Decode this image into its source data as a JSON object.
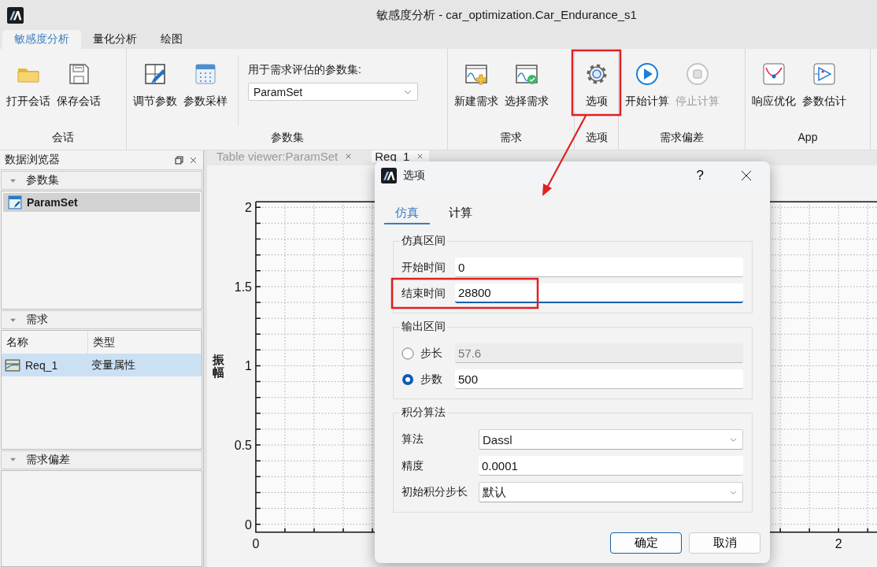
{
  "window": {
    "title": "敏感度分析 - car_optimization.Car_Endurance_s1"
  },
  "ribbon_tabs": [
    {
      "label": "敏感度分析",
      "selected": true
    },
    {
      "label": "量化分析",
      "selected": false
    },
    {
      "label": "绘图",
      "selected": false
    }
  ],
  "ribbon_groups": [
    {
      "title": "会话",
      "buttons": [
        {
          "label": "打开会话",
          "disabled": false
        },
        {
          "label": "保存会话",
          "disabled": false
        }
      ]
    },
    {
      "title": "参数集",
      "buttons": [
        {
          "label": "调节参数",
          "disabled": false
        },
        {
          "label": "参数采样",
          "disabled": false
        }
      ],
      "combo": {
        "label": "用于需求评估的参数集:",
        "value": "ParamSet"
      }
    },
    {
      "title": "需求",
      "buttons": [
        {
          "label": "新建需求",
          "disabled": false
        },
        {
          "label": "选择需求",
          "disabled": false
        }
      ]
    },
    {
      "title": "选项",
      "buttons": [
        {
          "label": "选项",
          "disabled": false
        }
      ]
    },
    {
      "title": "需求偏差",
      "buttons": [
        {
          "label": "开始计算",
          "disabled": false
        },
        {
          "label": "停止计算",
          "disabled": true
        }
      ]
    },
    {
      "title": "App",
      "buttons": [
        {
          "label": "响应优化",
          "disabled": false
        },
        {
          "label": "参数估计",
          "disabled": false
        }
      ]
    }
  ],
  "data_browser": {
    "title": "数据浏览器",
    "sections": [
      {
        "kind": "list",
        "title": "参数集",
        "expanded": true,
        "items": [
          {
            "label": "ParamSet",
            "selected": true
          }
        ]
      },
      {
        "kind": "table",
        "title": "需求",
        "expanded": true,
        "columns": [
          "名称",
          "类型"
        ],
        "rows": [
          {
            "cells": [
              "Req_1",
              "变量属性"
            ],
            "selected": true
          }
        ]
      },
      {
        "kind": "empty",
        "title": "需求偏差",
        "expanded": true
      }
    ]
  },
  "document_tabs": [
    {
      "label": "Table viewer:ParamSet",
      "selected": false
    },
    {
      "label": "Req_1",
      "selected": true
    }
  ],
  "plot": {
    "chart_data": {
      "type": "line",
      "grid": true,
      "ylabel": "振幅",
      "xlim": [
        0,
        2.132
      ],
      "ylim": [
        -0.05,
        2.035
      ],
      "xticks": [
        0,
        2
      ],
      "yticks": [
        0,
        0.5,
        1,
        1.5,
        2
      ]
    }
  },
  "dialog": {
    "title": "选项",
    "help": "?",
    "tabs": [
      {
        "label": "仿真",
        "selected": true
      },
      {
        "label": "计算",
        "selected": false
      }
    ],
    "groups": [
      {
        "title": "仿真区间",
        "rows": [
          {
            "kind": "field",
            "label": "开始时间",
            "value": "0",
            "focused": false
          },
          {
            "kind": "field",
            "label": "结束时间",
            "value": "28800",
            "focused": true
          }
        ]
      },
      {
        "title": "输出区间",
        "rows": [
          {
            "kind": "radio",
            "label": "步长",
            "value": "57.6",
            "selected": false
          },
          {
            "kind": "radio",
            "label": "步数",
            "value": "500",
            "selected": true
          }
        ]
      },
      {
        "title": "积分算法",
        "rows": [
          {
            "kind": "combo",
            "label": "算法",
            "value": "Dassl"
          },
          {
            "kind": "field",
            "label": "精度",
            "value": "0.0001",
            "focused": false
          },
          {
            "kind": "combo",
            "label": "初始积分步长",
            "value": "默认"
          }
        ]
      }
    ],
    "buttons": [
      {
        "label": "确定",
        "default": true
      },
      {
        "label": "取消",
        "default": false
      }
    ]
  }
}
